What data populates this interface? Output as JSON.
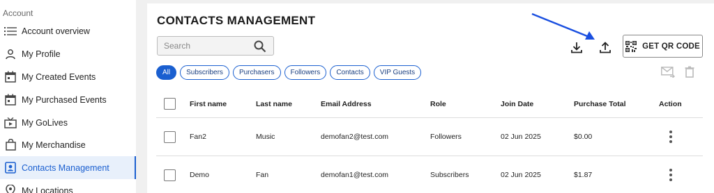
{
  "sidebar": {
    "header": "Account",
    "items": [
      {
        "label": "Account overview",
        "icon": "list-icon"
      },
      {
        "label": "My Profile",
        "icon": "person-icon"
      },
      {
        "label": "My Created Events",
        "icon": "calendar-icon"
      },
      {
        "label": "My Purchased Events",
        "icon": "calendar-icon"
      },
      {
        "label": "My GoLives",
        "icon": "live-tv-icon"
      },
      {
        "label": "My Merchandise",
        "icon": "shopping-bag-icon"
      },
      {
        "label": "Contacts Management",
        "icon": "contact-badge-icon",
        "active": true
      },
      {
        "label": "My Locations",
        "icon": "location-pin-icon"
      }
    ]
  },
  "main": {
    "title": "CONTACTS MANAGEMENT",
    "search_placeholder": "Search",
    "qr_button_label": "GET QR CODE",
    "chips": [
      "All",
      "Subscribers",
      "Purchasers",
      "Followers",
      "Contacts",
      "VIP Guests"
    ],
    "active_chip": "All"
  },
  "table": {
    "columns": [
      "First name",
      "Last name",
      "Email Address",
      "Role",
      "Join Date",
      "Purchase Total",
      "Action"
    ],
    "rows": [
      {
        "first": "Fan2",
        "last": "Music",
        "email": "demofan2@test.com",
        "role": "Followers",
        "join": "02 Jun 2025",
        "total": "$0.00"
      },
      {
        "first": "Demo",
        "last": "Fan",
        "email": "demofan1@test.com",
        "role": "Subscribers",
        "join": "02 Jun 2025",
        "total": "$1.87"
      }
    ]
  },
  "colors": {
    "accent": "#1a5fd0",
    "annotation_arrow": "#1a4fe0"
  }
}
